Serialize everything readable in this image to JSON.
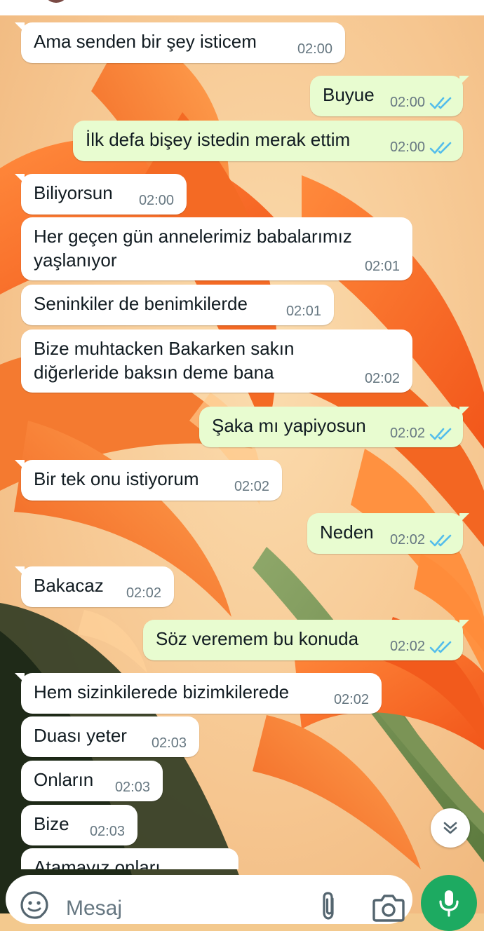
{
  "colors": {
    "incoming_bubble": "#ffffff",
    "outgoing_bubble": "#e8fcd0",
    "read_ticks": "#53bdeb",
    "timestamp": "#667781",
    "mic_button": "#1daa61"
  },
  "messages": [
    {
      "direction": "in",
      "text": "Ama senden bir şey isticem",
      "time": "02:00"
    },
    {
      "direction": "out",
      "text": "Buyue",
      "time": "02:00",
      "status": "read"
    },
    {
      "direction": "out",
      "text": "İlk defa bişey istedin merak ettim",
      "time": "02:00",
      "status": "read"
    },
    {
      "direction": "in",
      "text": "Biliyorsun",
      "time": "02:00"
    },
    {
      "direction": "in",
      "text": "Her geçen gün annelerimiz babalarımız\nyaşlanıyor",
      "time": "02:01"
    },
    {
      "direction": "in",
      "text": "Seninkiler de benimkilerde",
      "time": "02:01"
    },
    {
      "direction": "in",
      "text": "Bize muhtacken Bakarken sakın\ndiğerleride baksın deme bana",
      "time": "02:02"
    },
    {
      "direction": "out",
      "text": "Şaka mı yapiyosun",
      "time": "02:02",
      "status": "read"
    },
    {
      "direction": "in",
      "text": "Bir tek onu istiyorum",
      "time": "02:02"
    },
    {
      "direction": "out",
      "text": "Neden",
      "time": "02:02",
      "status": "read"
    },
    {
      "direction": "in",
      "text": "Bakacaz",
      "time": "02:02"
    },
    {
      "direction": "out",
      "text": "Söz veremem bu konuda",
      "time": "02:02",
      "status": "read"
    },
    {
      "direction": "in",
      "text": "Hem sizinkileredе bizimkilerede",
      "time": "02:02"
    },
    {
      "direction": "in",
      "text": "Duası yeter",
      "time": "02:03"
    },
    {
      "direction": "in",
      "text": "Onların",
      "time": "02:03"
    },
    {
      "direction": "in",
      "text": "Bize",
      "time": "02:03"
    },
    {
      "direction": "in",
      "text": "Atamayız onları",
      "time": ""
    }
  ],
  "composer": {
    "placeholder": "Mesaj",
    "icons": {
      "emoji": "sticker-emoji-icon",
      "attach": "paperclip-icon",
      "camera": "camera-icon",
      "mic": "microphone-icon",
      "scroll": "double-chevron-down-icon"
    }
  }
}
